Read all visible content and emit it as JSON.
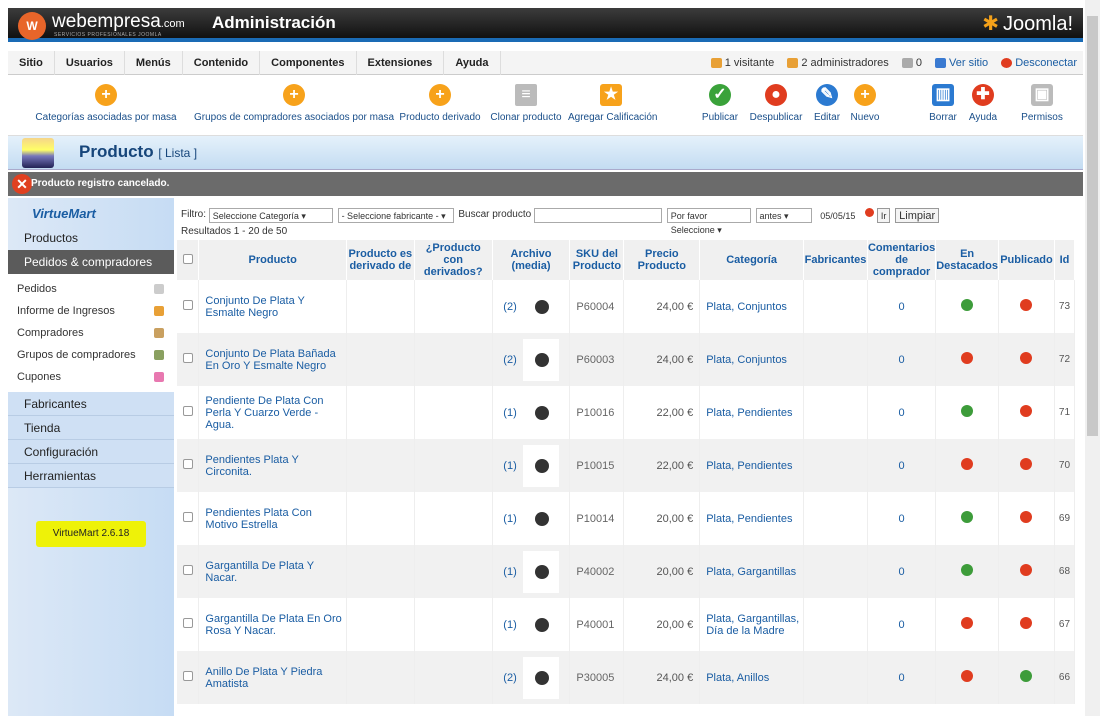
{
  "header": {
    "brand": "webempresa",
    "brand_suffix": ".com",
    "brand_sub": "SERVICIOS PROFESIONALES JOOMLA",
    "logo_glyph": "W",
    "title": "Administración",
    "joomla": "Joomla!"
  },
  "menu": {
    "items": [
      "Sitio",
      "Usuarios",
      "Menús",
      "Contenido",
      "Componentes",
      "Extensiones",
      "Ayuda"
    ],
    "visitors": "1 visitante",
    "admins": "2 administradores",
    "messages": "0",
    "view_site": "Ver sitio",
    "logout": "Desconectar"
  },
  "toolbar": {
    "cat_mass": "Categorías asociadas por masa",
    "groups_mass": "Grupos de compradores asociados por masa",
    "derived": "Producto derivado",
    "clone": "Clonar producto",
    "rate": "Agregar Calificación",
    "publish": "Publicar",
    "unpublish": "Despublicar",
    "edit": "Editar",
    "new": "Nuevo",
    "delete": "Borrar",
    "help": "Ayuda",
    "perms": "Permisos"
  },
  "page": {
    "title": "Producto",
    "subtitle": "[ Lista ]"
  },
  "message": "Producto registro cancelado.",
  "sidebar": {
    "logo": "VirtueMart",
    "products": "Productos",
    "orders_head": "Pedidos & compradores",
    "items": [
      "Pedidos",
      "Informe de Ingresos",
      "Compradores",
      "Grupos de compradores",
      "Cupones"
    ],
    "sections": [
      "Fabricantes",
      "Tienda",
      "Configuración",
      "Herramientas"
    ],
    "version": "VirtueMart 2.6.18"
  },
  "filter": {
    "label": "Filtro:",
    "category": "Seleccione Categoría",
    "manufacturer": "- Seleccione fabricante -",
    "search_label": "Buscar producto",
    "please": "Por favor Seleccione",
    "before": "antes",
    "date": "05/05/15",
    "go": "Ir",
    "clear": "Limpiar",
    "results": "Resultados 1 - 20 de 50"
  },
  "columns": {
    "product": "Producto",
    "derived_of": "Producto es derivado de",
    "has_derived": "¿Producto con derivados?",
    "media": "Archivo (media)",
    "sku": "SKU del Producto",
    "price": "Precio Producto",
    "category": "Categoría",
    "manufacturers": "Fabricantes",
    "comments": "Comentarios de comprador",
    "featured": "En Destacados",
    "published": "Publicado",
    "id": "Id"
  },
  "rows": [
    {
      "name": "Conjunto De Plata Y Esmalte Negro",
      "media": "(2)",
      "sku": "P60004",
      "price": "24,00 €",
      "category": "Plata, Conjuntos",
      "comments": "0",
      "featured": true,
      "published": false,
      "id": "73"
    },
    {
      "name": "Conjunto De Plata Bañada En Oro Y Esmalte Negro",
      "media": "(2)",
      "sku": "P60003",
      "price": "24,00 €",
      "category": "Plata, Conjuntos",
      "comments": "0",
      "featured": false,
      "published": false,
      "id": "72"
    },
    {
      "name": "Pendiente De Plata Con Perla Y Cuarzo Verde - Agua.",
      "media": "(1)",
      "sku": "P10016",
      "price": "22,00 €",
      "category": "Plata, Pendientes",
      "comments": "0",
      "featured": true,
      "published": false,
      "id": "71"
    },
    {
      "name": "Pendientes Plata Y Circonita.",
      "media": "(1)",
      "sku": "P10015",
      "price": "22,00 €",
      "category": "Plata, Pendientes",
      "comments": "0",
      "featured": false,
      "published": false,
      "id": "70"
    },
    {
      "name": "Pendientes Plata Con Motivo Estrella",
      "media": "(1)",
      "sku": "P10014",
      "price": "20,00 €",
      "category": "Plata, Pendientes",
      "comments": "0",
      "featured": true,
      "published": false,
      "id": "69"
    },
    {
      "name": "Gargantilla De Plata Y Nacar.",
      "media": "(1)",
      "sku": "P40002",
      "price": "20,00 €",
      "category": "Plata, Gargantillas",
      "comments": "0",
      "featured": true,
      "published": false,
      "id": "68"
    },
    {
      "name": "Gargantilla De Plata En Oro Rosa Y Nacar.",
      "media": "(1)",
      "sku": "P40001",
      "price": "20,00 €",
      "category": "Plata, Gargantillas, Día de la Madre",
      "comments": "0",
      "featured": false,
      "published": false,
      "id": "67"
    },
    {
      "name": "Anillo De Plata Y Piedra Amatista",
      "media": "(2)",
      "sku": "P30005",
      "price": "24,00 €",
      "category": "Plata, Anillos",
      "comments": "0",
      "featured": false,
      "published": true,
      "id": "66"
    }
  ]
}
